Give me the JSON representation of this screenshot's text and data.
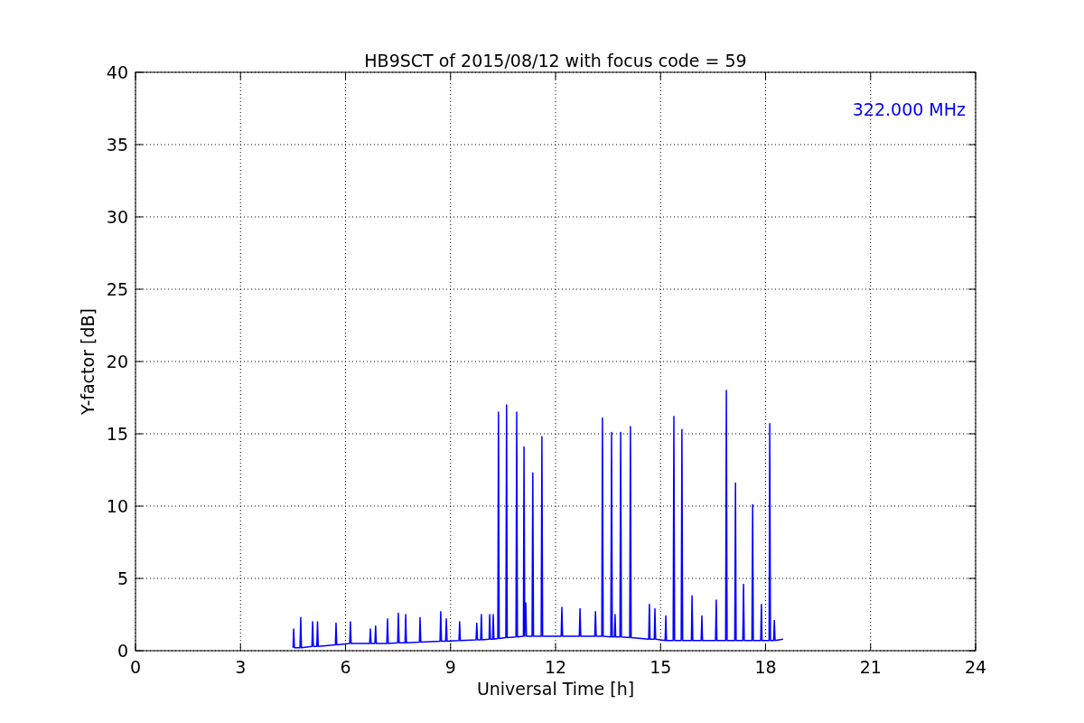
{
  "figure": {
    "chart_data": {
      "type": "line",
      "title": "HB9SCT of 2015/08/12 with focus code = 59",
      "xlabel": "Universal Time [h]",
      "ylabel": "Y-factor [dB]",
      "xlim": [
        0,
        24
      ],
      "ylim": [
        0,
        40
      ],
      "xticks": [
        0,
        3,
        6,
        9,
        12,
        15,
        18,
        21,
        24
      ],
      "yticks": [
        0,
        5,
        10,
        15,
        20,
        25,
        30,
        35,
        40
      ],
      "grid": true,
      "annotations": [
        "322.000 MHz"
      ],
      "x": [
        4.5,
        4.52,
        4.54,
        4.7,
        4.72,
        4.74,
        5.04,
        5.06,
        5.08,
        5.18,
        5.2,
        5.22,
        5.71,
        5.73,
        5.75,
        6.12,
        6.14,
        6.16,
        6.69,
        6.71,
        6.73,
        6.84,
        6.86,
        6.88,
        7.18,
        7.2,
        7.22,
        7.49,
        7.51,
        7.53,
        7.7,
        7.72,
        7.74,
        8.11,
        8.13,
        8.15,
        8.7,
        8.72,
        8.74,
        8.86,
        8.88,
        8.9,
        9.24,
        9.26,
        9.28,
        9.73,
        9.75,
        9.77,
        9.86,
        9.88,
        9.9,
        10.1,
        10.12,
        10.14,
        10.2,
        10.22,
        10.24,
        10.35,
        10.37,
        10.39,
        10.58,
        10.6,
        10.62,
        10.87,
        10.89,
        10.91,
        11.08,
        11.1,
        11.12,
        11.15,
        11.17,
        11.33,
        11.35,
        11.37,
        11.59,
        11.61,
        11.63,
        12.16,
        12.18,
        12.2,
        12.68,
        12.7,
        12.72,
        13.12,
        13.14,
        13.16,
        13.32,
        13.34,
        13.36,
        13.58,
        13.6,
        13.62,
        13.68,
        13.7,
        13.72,
        13.84,
        13.86,
        13.88,
        14.12,
        14.14,
        14.16,
        14.66,
        14.68,
        14.7,
        14.82,
        14.84,
        14.86,
        15.13,
        15.15,
        15.17,
        15.36,
        15.38,
        15.4,
        15.59,
        15.61,
        15.63,
        15.88,
        15.9,
        15.92,
        16.16,
        16.18,
        16.2,
        16.57,
        16.59,
        16.61,
        16.86,
        16.88,
        16.9,
        17.12,
        17.14,
        17.16,
        17.35,
        17.37,
        17.39,
        17.61,
        17.63,
        17.65,
        17.86,
        17.88,
        17.9,
        18.1,
        18.12,
        18.14,
        18.23,
        18.25,
        18.27,
        18.5
      ],
      "series": [
        {
          "color": "#0000ff",
          "values": [
            0.2,
            1.5,
            0.2,
            0.2,
            2.3,
            0.2,
            0.3,
            2.0,
            0.3,
            0.3,
            2.0,
            0.3,
            0.4,
            1.9,
            0.4,
            0.5,
            2.0,
            0.5,
            0.5,
            1.5,
            0.5,
            0.5,
            1.7,
            0.5,
            0.5,
            2.2,
            0.5,
            0.55,
            2.6,
            0.55,
            0.55,
            2.5,
            0.55,
            0.6,
            2.3,
            0.6,
            0.65,
            2.7,
            0.65,
            0.65,
            2.2,
            0.65,
            0.7,
            2.0,
            0.7,
            0.75,
            1.9,
            0.75,
            0.75,
            2.5,
            0.75,
            0.8,
            2.5,
            0.8,
            0.8,
            2.5,
            0.8,
            0.85,
            16.5,
            0.85,
            0.9,
            17.0,
            0.9,
            0.95,
            16.5,
            0.95,
            1.0,
            14.1,
            1.0,
            3.3,
            1.0,
            1.0,
            12.3,
            1.0,
            1.0,
            14.8,
            1.0,
            1.0,
            3.0,
            1.0,
            1.0,
            2.9,
            1.0,
            1.0,
            2.7,
            1.0,
            1.0,
            16.1,
            1.0,
            0.95,
            15.1,
            0.95,
            0.95,
            2.5,
            0.95,
            0.95,
            15.1,
            0.95,
            0.9,
            15.5,
            0.9,
            0.8,
            3.2,
            0.8,
            0.8,
            2.9,
            0.8,
            0.7,
            2.4,
            0.7,
            0.7,
            16.2,
            0.7,
            0.7,
            15.3,
            0.7,
            0.7,
            3.8,
            0.7,
            0.7,
            2.4,
            0.7,
            0.7,
            3.5,
            0.7,
            0.7,
            18.0,
            0.7,
            0.7,
            11.6,
            0.7,
            0.7,
            4.6,
            0.7,
            0.7,
            10.1,
            0.7,
            0.7,
            3.2,
            0.7,
            0.7,
            15.7,
            0.7,
            0.7,
            2.1,
            0.7,
            0.8
          ]
        }
      ]
    }
  }
}
